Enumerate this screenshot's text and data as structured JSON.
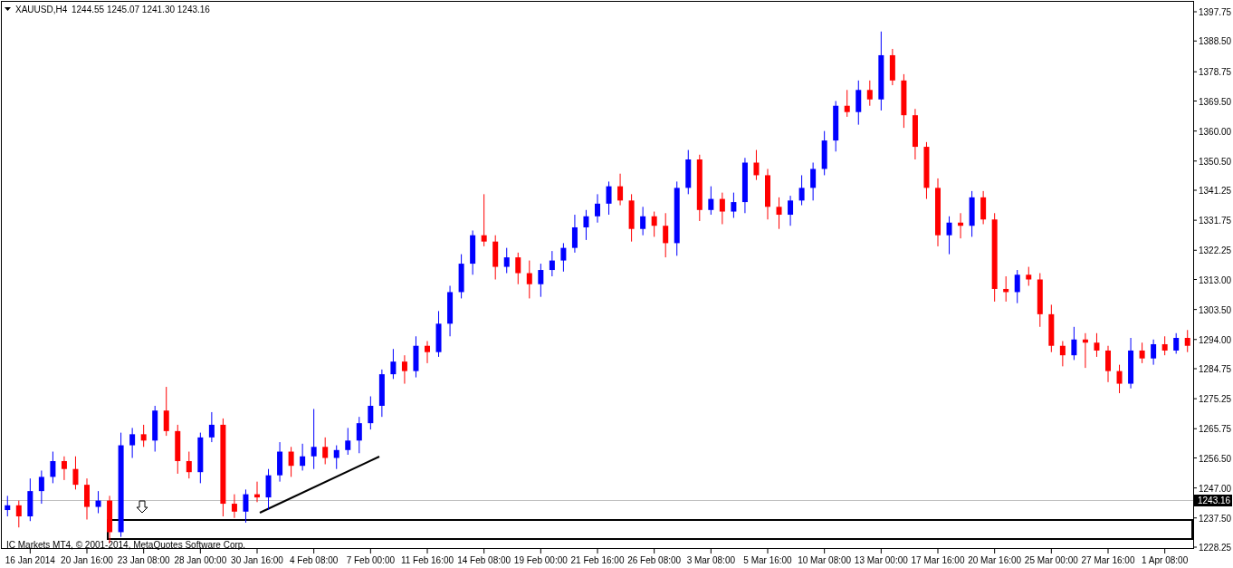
{
  "header": {
    "symbol": "XAUUSD,H4",
    "quote": "1244.55 1245.07 1241.30 1243.16"
  },
  "current_price": "1243.16",
  "chart_data": {
    "type": "candlestick",
    "ylim": [
      1227.82,
      1401.05
    ],
    "yticks": [
      {
        "value": 1397.75,
        "label": "1397.75"
      },
      {
        "value": 1388.5,
        "label": "1388.50"
      },
      {
        "value": 1378.75,
        "label": "1378.75"
      },
      {
        "value": 1369.5,
        "label": "1369.50"
      },
      {
        "value": 1360,
        "label": "1360.00"
      },
      {
        "value": 1350.5,
        "label": "1350.50"
      },
      {
        "value": 1341.25,
        "label": "1341.25"
      },
      {
        "value": 1331.75,
        "label": "1331.75"
      },
      {
        "value": 1322.25,
        "label": "1322.25"
      },
      {
        "value": 1313,
        "label": "1313.00"
      },
      {
        "value": 1303.5,
        "label": "1303.50"
      },
      {
        "value": 1294,
        "label": "1294.00"
      },
      {
        "value": 1284.75,
        "label": "1284.75"
      },
      {
        "value": 1275.25,
        "label": "1275.25"
      },
      {
        "value": 1265.75,
        "label": "1265.75"
      },
      {
        "value": 1256.5,
        "label": "1256.50"
      },
      {
        "value": 1247,
        "label": "1247.00"
      },
      {
        "value": 1237.5,
        "label": "1237.50"
      },
      {
        "value": 1228.25,
        "label": "1228.25"
      }
    ],
    "categories": [
      null,
      null,
      "16 Jan 2014",
      null,
      null,
      null,
      null,
      "20 Jan 16:00",
      null,
      null,
      null,
      null,
      "23 Jan 08:00",
      null,
      null,
      null,
      null,
      "28 Jan 00:00",
      null,
      null,
      null,
      null,
      "30 Jan 16:00",
      null,
      null,
      null,
      null,
      "4 Feb 08:00",
      null,
      null,
      null,
      null,
      "7 Feb 00:00",
      null,
      null,
      null,
      null,
      "11 Feb 16:00",
      null,
      null,
      null,
      null,
      "14 Feb 08:00",
      null,
      null,
      null,
      null,
      "19 Feb 00:00",
      null,
      null,
      null,
      null,
      "21 Feb 16:00",
      null,
      null,
      null,
      null,
      "26 Feb 08:00",
      null,
      null,
      null,
      null,
      "3 Mar 08:00",
      null,
      null,
      null,
      null,
      "5 Mar 16:00",
      null,
      null,
      null,
      null,
      "10 Mar 08:00",
      null,
      null,
      null,
      null,
      "13 Mar 00:00",
      null,
      null,
      null,
      null,
      "17 Mar 16:00",
      null,
      null,
      null,
      null,
      "20 Mar 16:00",
      null,
      null,
      null,
      null,
      "25 Mar 00:00",
      null,
      null,
      null,
      null,
      "27 Mar 16:00",
      null,
      null,
      null,
      null,
      "1 Apr 08:00",
      null,
      null
    ],
    "ohlc": [
      [
        1240.0,
        1244.5,
        1238.0,
        1241.5
      ],
      [
        1241.5,
        1243.0,
        1234.5,
        1238.0
      ],
      [
        1238.0,
        1250.0,
        1236.5,
        1246.0
      ],
      [
        1246.0,
        1252.5,
        1242.0,
        1250.5
      ],
      [
        1250.5,
        1258.5,
        1248.5,
        1255.5
      ],
      [
        1255.5,
        1257.0,
        1249.5,
        1253.0
      ],
      [
        1253.0,
        1257.0,
        1246.5,
        1248.0
      ],
      [
        1248.0,
        1250.0,
        1237.0,
        1241.0
      ],
      [
        1241.0,
        1246.0,
        1239.0,
        1243.0
      ],
      [
        1243.0,
        1244.5,
        1229.5,
        1233.0
      ],
      [
        1233.0,
        1264.5,
        1231.5,
        1260.5
      ],
      [
        1260.5,
        1266.0,
        1256.5,
        1264.0
      ],
      [
        1264.0,
        1267.0,
        1260.0,
        1262.0
      ],
      [
        1262.0,
        1273.0,
        1258.5,
        1271.5
      ],
      [
        1271.5,
        1279.0,
        1263.5,
        1265.0
      ],
      [
        1265.0,
        1267.0,
        1251.5,
        1255.5
      ],
      [
        1255.5,
        1258.5,
        1250.0,
        1252.0
      ],
      [
        1252.0,
        1264.5,
        1248.5,
        1263.0
      ],
      [
        1263.0,
        1271.0,
        1261.5,
        1267.0
      ],
      [
        1267.0,
        1269.0,
        1238.0,
        1242.0
      ],
      [
        1242.0,
        1245.0,
        1237.5,
        1239.5
      ],
      [
        1239.5,
        1246.5,
        1236.0,
        1245.0
      ],
      [
        1245.0,
        1249.0,
        1242.5,
        1244.0
      ],
      [
        1244.0,
        1253.0,
        1240.0,
        1251.0
      ],
      [
        1251.0,
        1261.5,
        1249.0,
        1258.5
      ],
      [
        1258.5,
        1260.0,
        1250.5,
        1254.0
      ],
      [
        1254.0,
        1261.0,
        1252.5,
        1257.0
      ],
      [
        1257.0,
        1272.0,
        1253.0,
        1260.0
      ],
      [
        1260.0,
        1263.0,
        1254.5,
        1256.5
      ],
      [
        1256.5,
        1260.5,
        1253.0,
        1259.0
      ],
      [
        1259.0,
        1266.0,
        1257.5,
        1262.0
      ],
      [
        1262.0,
        1269.5,
        1258.0,
        1267.5
      ],
      [
        1267.5,
        1276.0,
        1265.5,
        1273.0
      ],
      [
        1273.0,
        1284.5,
        1269.5,
        1283.0
      ],
      [
        1283.0,
        1291.0,
        1281.5,
        1287.0
      ],
      [
        1287.0,
        1289.0,
        1280.0,
        1284.0
      ],
      [
        1284.0,
        1295.0,
        1282.0,
        1292.0
      ],
      [
        1292.0,
        1293.5,
        1286.5,
        1290.0
      ],
      [
        1290.0,
        1303.0,
        1288.5,
        1299.0
      ],
      [
        1299.0,
        1311.0,
        1295.0,
        1309.0
      ],
      [
        1309.0,
        1321.0,
        1307.0,
        1318.0
      ],
      [
        1318.0,
        1328.5,
        1314.5,
        1327.0
      ],
      [
        1327.0,
        1340.0,
        1323.5,
        1325.0
      ],
      [
        1325.0,
        1327.0,
        1313.0,
        1317.0
      ],
      [
        1317.0,
        1323.0,
        1315.0,
        1320.0
      ],
      [
        1320.0,
        1321.5,
        1311.5,
        1315.0
      ],
      [
        1315.0,
        1319.0,
        1307.0,
        1311.5
      ],
      [
        1311.5,
        1318.0,
        1307.5,
        1316.0
      ],
      [
        1316.0,
        1322.0,
        1314.0,
        1319.0
      ],
      [
        1319.0,
        1324.5,
        1315.5,
        1323.0
      ],
      [
        1323.0,
        1333.5,
        1321.5,
        1329.5
      ],
      [
        1329.5,
        1335.0,
        1325.5,
        1333.0
      ],
      [
        1333.0,
        1340.0,
        1331.0,
        1337.0
      ],
      [
        1337.0,
        1344.0,
        1333.5,
        1342.5
      ],
      [
        1342.5,
        1346.5,
        1336.5,
        1338.0
      ],
      [
        1338.0,
        1340.0,
        1325.0,
        1329.0
      ],
      [
        1329.0,
        1336.0,
        1327.0,
        1333.0
      ],
      [
        1333.0,
        1334.5,
        1326.5,
        1330.0
      ],
      [
        1330.0,
        1334.0,
        1320.0,
        1324.5
      ],
      [
        1324.5,
        1344.0,
        1320.5,
        1342.0
      ],
      [
        1342.0,
        1354.0,
        1340.0,
        1351.0
      ],
      [
        1351.0,
        1352.5,
        1331.5,
        1335.0
      ],
      [
        1335.0,
        1342.5,
        1333.5,
        1338.5
      ],
      [
        1338.5,
        1340.5,
        1330.5,
        1334.5
      ],
      [
        1334.5,
        1340.5,
        1332.5,
        1337.5
      ],
      [
        1337.5,
        1351.5,
        1334.0,
        1350.0
      ],
      [
        1350.0,
        1354.0,
        1344.5,
        1346.0
      ],
      [
        1346.0,
        1348.0,
        1332.0,
        1336.0
      ],
      [
        1336.0,
        1339.0,
        1329.0,
        1333.5
      ],
      [
        1333.5,
        1339.5,
        1330.0,
        1338.0
      ],
      [
        1338.0,
        1346.0,
        1336.5,
        1342.0
      ],
      [
        1342.0,
        1350.0,
        1338.0,
        1348.0
      ],
      [
        1348.0,
        1360.0,
        1346.0,
        1357.0
      ],
      [
        1357.0,
        1369.5,
        1353.5,
        1368.0
      ],
      [
        1368.0,
        1373.0,
        1364.5,
        1366.0
      ],
      [
        1366.0,
        1376.0,
        1362.0,
        1373.0
      ],
      [
        1373.0,
        1376.0,
        1368.0,
        1370.0
      ],
      [
        1370.0,
        1391.5,
        1366.5,
        1384.0
      ],
      [
        1384.0,
        1386.0,
        1374.5,
        1376.0
      ],
      [
        1376.0,
        1378.0,
        1361.0,
        1365.0
      ],
      [
        1365.0,
        1367.0,
        1351.0,
        1355.0
      ],
      [
        1355.0,
        1356.5,
        1338.5,
        1342.0
      ],
      [
        1342.0,
        1345.0,
        1323.5,
        1327.0
      ],
      [
        1327.0,
        1333.0,
        1321.0,
        1331.0
      ],
      [
        1331.0,
        1334.0,
        1326.0,
        1330.0
      ],
      [
        1330.0,
        1341.0,
        1326.5,
        1339.0
      ],
      [
        1339.0,
        1341.0,
        1330.5,
        1332.0
      ],
      [
        1332.0,
        1334.0,
        1306.0,
        1310.0
      ],
      [
        1310.0,
        1314.0,
        1306.0,
        1309.0
      ],
      [
        1309.0,
        1316.0,
        1305.5,
        1314.5
      ],
      [
        1314.5,
        1317.0,
        1311.0,
        1313.0
      ],
      [
        1313.0,
        1315.0,
        1298.0,
        1302.0
      ],
      [
        1302.0,
        1305.0,
        1290.0,
        1292.0
      ],
      [
        1292.0,
        1293.5,
        1285.5,
        1289.0
      ],
      [
        1289.0,
        1298.0,
        1287.5,
        1294.0
      ],
      [
        1294.0,
        1296.0,
        1285.0,
        1293.0
      ],
      [
        1293.0,
        1296.0,
        1288.5,
        1290.5
      ],
      [
        1290.5,
        1292.0,
        1280.5,
        1284.0
      ],
      [
        1284.0,
        1286.0,
        1277.0,
        1280.0
      ],
      [
        1280.0,
        1294.5,
        1278.5,
        1290.5
      ],
      [
        1290.5,
        1293.0,
        1286.5,
        1288.0
      ],
      [
        1288.0,
        1294.0,
        1286.0,
        1292.5
      ],
      [
        1292.5,
        1295.0,
        1289.0,
        1290.5
      ],
      [
        1290.5,
        1296.0,
        1289.5,
        1294.5
      ],
      [
        1294.5,
        1297.0,
        1290.0,
        1292.0
      ]
    ]
  },
  "footer": "IC Markets MT4, © 2001-2014, MetaQuotes Software Corp."
}
